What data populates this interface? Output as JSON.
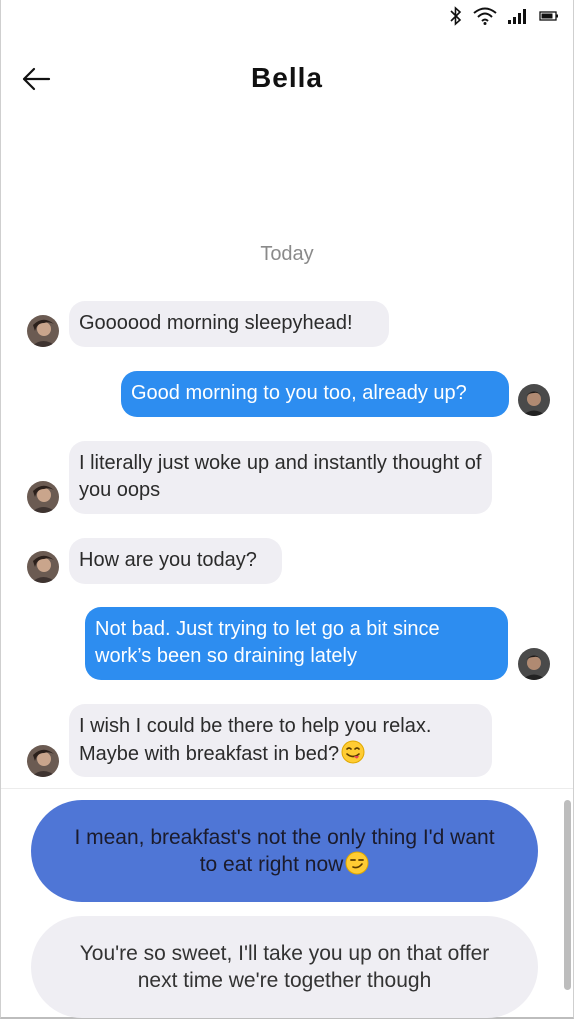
{
  "status_bar": {
    "icons": [
      "bluetooth-icon",
      "wifi-icon",
      "signal-icon",
      "battery-icon"
    ]
  },
  "header": {
    "back_icon": "arrow-left-icon",
    "title": "Bella"
  },
  "chat": {
    "date_separator": "Today",
    "messages": [
      {
        "sender": "Bella",
        "direction": "incoming",
        "text": "Goooood morning sleepyhead!"
      },
      {
        "sender": "me",
        "direction": "outgoing",
        "text": "Good morning to you too, already up?"
      },
      {
        "sender": "Bella",
        "direction": "incoming",
        "text": "I literally just woke up and instantly thought of you oops"
      },
      {
        "sender": "Bella",
        "direction": "incoming",
        "text": "How are you today?"
      },
      {
        "sender": "me",
        "direction": "outgoing",
        "text": "Not bad. Just trying to let go a bit since work’s been so draining lately"
      },
      {
        "sender": "Bella",
        "direction": "incoming",
        "text": "I wish I could be there to help you relax. Maybe with breakfast in bed?",
        "emoji": "yum-face-emoji"
      }
    ]
  },
  "replies": [
    {
      "text": "I mean, breakfast's not the only thing I'd want to eat right now",
      "emoji": "smirk-face-emoji"
    },
    {
      "text": "You're so sweet, I'll take you up on that offer next time we're together though"
    }
  ],
  "colors": {
    "incoming_bubble": "#efeef3",
    "outgoing_bubble": "#2d8df0",
    "primary_reply": "#4f76d6",
    "secondary_reply": "#efeef3"
  }
}
